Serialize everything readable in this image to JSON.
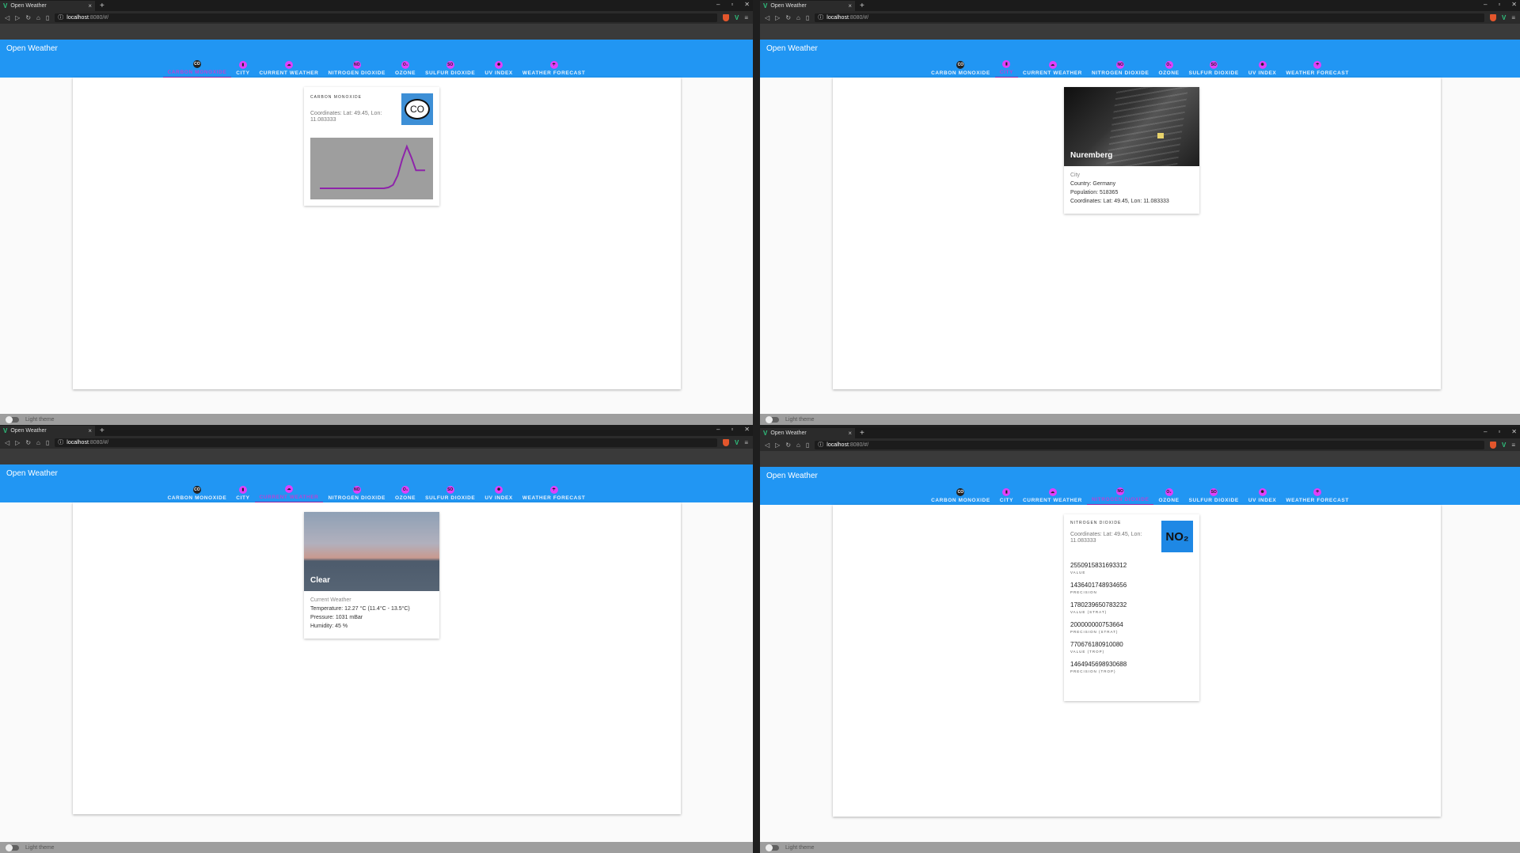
{
  "browser": {
    "tab_title": "Open Weather",
    "tab_close": "×",
    "new_tab": "+",
    "url_host": "localhost",
    "url_rest": ":8080/#/",
    "window_controls": [
      "–",
      "▫",
      "✕"
    ]
  },
  "app": {
    "title": "Open Weather",
    "theme_label": "Light theme"
  },
  "nav_tabs": [
    {
      "label": "CARBON MONOXIDE",
      "icon": "co-icon",
      "glyph": "CO"
    },
    {
      "label": "CITY",
      "icon": "city-icon",
      "glyph": "▮"
    },
    {
      "label": "CURRENT WEATHER",
      "icon": "weather-icon",
      "glyph": "☁"
    },
    {
      "label": "NITROGEN DIOXIDE",
      "icon": "no2-icon",
      "glyph": "NO"
    },
    {
      "label": "OZONE",
      "icon": "ozone-icon",
      "glyph": "O₃"
    },
    {
      "label": "SULFUR DIOXIDE",
      "icon": "so2-icon",
      "glyph": "SO"
    },
    {
      "label": "UV INDEX",
      "icon": "uv-icon",
      "glyph": "✺"
    },
    {
      "label": "WEATHER FORECAST",
      "icon": "forecast-icon",
      "glyph": "☂"
    }
  ],
  "colors": {
    "appbar": "#2196f3",
    "active_tab": "#9c27b0",
    "chart_line": "#8e24aa",
    "chart_bg": "#9e9e9e"
  },
  "panels": {
    "carbon_monoxide": {
      "overline": "CARBON MONOXIDE",
      "coords": "Coordinates: Lat: 49.45, Lon: 11.083333",
      "logo_text": "CO"
    },
    "city": {
      "image_caption": "Nuremberg",
      "subtitle": "City",
      "country": "Country: Germany",
      "population": "Population: 518365",
      "coords": "Coordinates: Lat: 49.45, Lon: 11.083333"
    },
    "current_weather": {
      "image_caption": "Clear",
      "subtitle": "Current Weather",
      "temperature": "Temperature: 12.27 °C (11.4°C - 13.5°C)",
      "pressure": "Pressure: 1031 mBar",
      "humidity": "Humidity: 45 %"
    },
    "nitrogen_dioxide": {
      "overline": "NITROGEN DIOXIDE",
      "coords": "Coordinates: Lat: 49.45, Lon: 11.083333",
      "logo_text": "NO₂",
      "values": [
        {
          "value": "2550915831693312",
          "label": "VALUE"
        },
        {
          "value": "1436401748934656",
          "label": "PRECISION"
        },
        {
          "value": "1780239650783232",
          "label": "VALUE (STRAT)"
        },
        {
          "value": "200000000753664",
          "label": "PRECISION (STRAT)"
        },
        {
          "value": "770676180910080",
          "label": "VALUE (TROP)"
        },
        {
          "value": "1464945698930688",
          "label": "PRECISION (TROP)"
        }
      ]
    }
  },
  "chart_data": {
    "type": "line",
    "title": "",
    "xlabel": "",
    "ylabel": "",
    "grid": false,
    "series": [
      {
        "values": [
          0,
          0,
          0,
          0,
          0,
          0,
          0,
          0,
          0,
          0,
          0,
          0,
          0,
          0,
          0,
          0.02,
          0.08,
          0.3,
          0.68,
          0.98,
          0.72,
          0.42,
          0.42,
          0.42
        ]
      }
    ]
  }
}
